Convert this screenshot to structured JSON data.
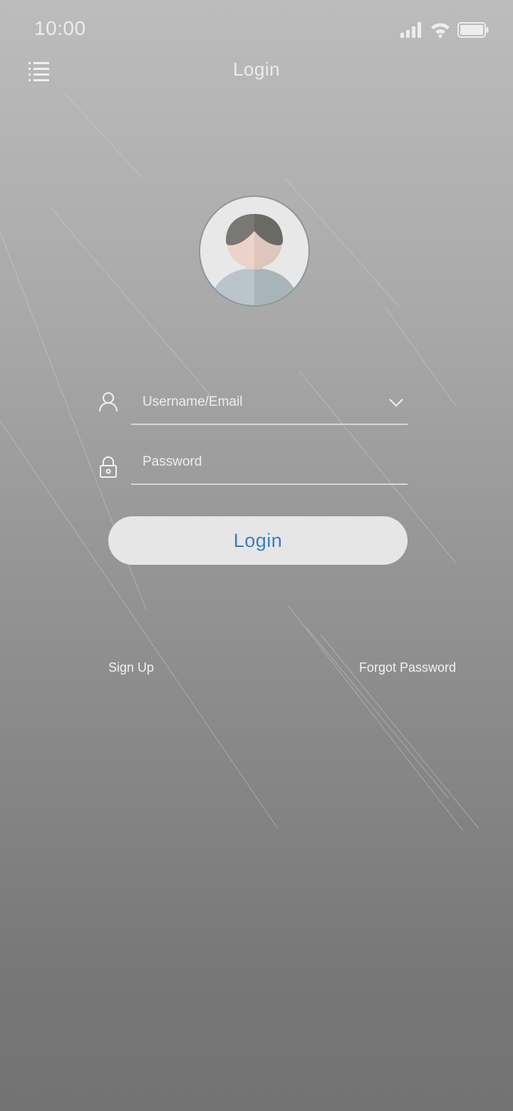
{
  "status_bar": {
    "time": "10:00",
    "signal_icon": "cellular-signal-icon",
    "wifi_icon": "wifi-icon",
    "battery_icon": "battery-icon"
  },
  "header": {
    "menu_icon": "list-menu-icon",
    "title": "Login"
  },
  "avatar": {
    "icon": "default-user-avatar"
  },
  "form": {
    "username": {
      "icon": "user-icon",
      "value": "",
      "placeholder": "Username/Email",
      "dropdown_icon": "chevron-down-icon"
    },
    "password": {
      "icon": "lock-icon",
      "value": "",
      "placeholder": "Password"
    },
    "login_button_label": "Login"
  },
  "links": {
    "sign_up": "Sign Up",
    "forgot_password": "Forgot Password"
  },
  "colors": {
    "accent": "#3b7ec3",
    "button_bg": "#e6e6e6",
    "text_light": "#ececec",
    "background_top": "#bcbcbc",
    "background_bottom": "#727372"
  }
}
